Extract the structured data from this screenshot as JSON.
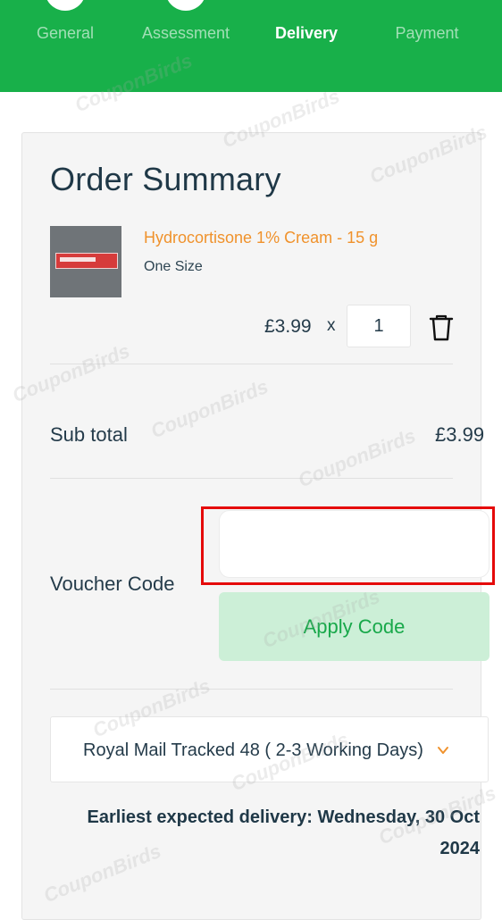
{
  "stepper": {
    "steps": [
      {
        "label": "General",
        "active": false
      },
      {
        "label": "Assessment",
        "active": false
      },
      {
        "label": "Delivery",
        "active": true
      },
      {
        "label": "Payment",
        "active": false
      }
    ]
  },
  "order_summary": {
    "title": "Order Summary",
    "item": {
      "name": "Hydrocortisone 1% Cream - 15 g",
      "size": "One Size",
      "price": "£3.99",
      "times_symbol": "x",
      "quantity": "1",
      "remove_icon": "trash-icon"
    },
    "subtotal_label": "Sub total",
    "subtotal_value": "£3.99",
    "voucher": {
      "label": "Voucher Code",
      "value": "",
      "apply_label": "Apply Code"
    },
    "delivery": {
      "selected_option": "Royal Mail Tracked 48 ( 2-3 Working Days)",
      "expected_text": "Earliest expected delivery: Wednesday, 30 Oct 2024"
    }
  },
  "watermark": "CouponBirds",
  "colors": {
    "brand_green": "#18b04a",
    "accent_orange": "#f0922c",
    "highlight_red": "#e50a0a",
    "button_bg": "#ccefd7"
  }
}
